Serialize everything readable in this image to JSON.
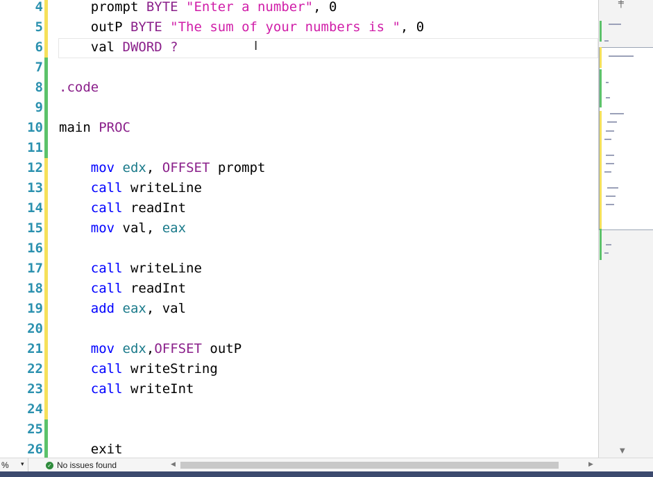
{
  "editor": {
    "lines": [
      {
        "num": "4",
        "marker": "yellow",
        "tokens": [
          {
            "t": "    "
          },
          {
            "t": "prompt ",
            "c": "lbl"
          },
          {
            "t": "BYTE ",
            "c": "dir"
          },
          {
            "t": "\"Enter a number\"",
            "c": "str"
          },
          {
            "t": ", 0"
          }
        ]
      },
      {
        "num": "5",
        "marker": "yellow",
        "tokens": [
          {
            "t": "    "
          },
          {
            "t": "outP ",
            "c": "lbl"
          },
          {
            "t": "BYTE ",
            "c": "dir"
          },
          {
            "t": "\"The sum of your numbers is \"",
            "c": "str"
          },
          {
            "t": ", 0"
          }
        ]
      },
      {
        "num": "6",
        "marker": "yellow",
        "tokens": [
          {
            "t": "    "
          },
          {
            "t": "val ",
            "c": "lbl"
          },
          {
            "t": "DWORD ?",
            "c": "dir"
          }
        ],
        "current": true
      },
      {
        "num": "7",
        "marker": "green",
        "tokens": []
      },
      {
        "num": "8",
        "marker": "green",
        "tokens": [
          {
            "t": ".code",
            "c": "dir"
          }
        ]
      },
      {
        "num": "9",
        "marker": "green",
        "tokens": []
      },
      {
        "num": "10",
        "marker": "green",
        "tokens": [
          {
            "t": "main "
          },
          {
            "t": "PROC",
            "c": "dir"
          }
        ]
      },
      {
        "num": "11",
        "marker": "green",
        "tokens": []
      },
      {
        "num": "12",
        "marker": "yellow",
        "tokens": [
          {
            "t": "    "
          },
          {
            "t": "mov ",
            "c": "kw"
          },
          {
            "t": "edx",
            "c": "reg"
          },
          {
            "t": ", "
          },
          {
            "t": "OFFSET ",
            "c": "dir"
          },
          {
            "t": "prompt"
          }
        ]
      },
      {
        "num": "13",
        "marker": "yellow",
        "tokens": [
          {
            "t": "    "
          },
          {
            "t": "call ",
            "c": "kw"
          },
          {
            "t": "writeLine"
          }
        ]
      },
      {
        "num": "14",
        "marker": "yellow",
        "tokens": [
          {
            "t": "    "
          },
          {
            "t": "call ",
            "c": "kw"
          },
          {
            "t": "readInt"
          }
        ]
      },
      {
        "num": "15",
        "marker": "yellow",
        "tokens": [
          {
            "t": "    "
          },
          {
            "t": "mov ",
            "c": "kw"
          },
          {
            "t": "val, "
          },
          {
            "t": "eax",
            "c": "reg"
          }
        ]
      },
      {
        "num": "16",
        "marker": "yellow",
        "tokens": []
      },
      {
        "num": "17",
        "marker": "yellow",
        "tokens": [
          {
            "t": "    "
          },
          {
            "t": "call ",
            "c": "kw"
          },
          {
            "t": "writeLine"
          }
        ]
      },
      {
        "num": "18",
        "marker": "yellow",
        "tokens": [
          {
            "t": "    "
          },
          {
            "t": "call ",
            "c": "kw"
          },
          {
            "t": "readInt"
          }
        ]
      },
      {
        "num": "19",
        "marker": "yellow",
        "tokens": [
          {
            "t": "    "
          },
          {
            "t": "add ",
            "c": "kw"
          },
          {
            "t": "eax",
            "c": "reg"
          },
          {
            "t": ", val"
          }
        ]
      },
      {
        "num": "20",
        "marker": "yellow",
        "tokens": []
      },
      {
        "num": "21",
        "marker": "yellow",
        "tokens": [
          {
            "t": "    "
          },
          {
            "t": "mov ",
            "c": "kw"
          },
          {
            "t": "edx",
            "c": "reg"
          },
          {
            "t": ","
          },
          {
            "t": "OFFSET ",
            "c": "dir"
          },
          {
            "t": "outP"
          }
        ]
      },
      {
        "num": "22",
        "marker": "yellow",
        "tokens": [
          {
            "t": "    "
          },
          {
            "t": "call ",
            "c": "kw"
          },
          {
            "t": "writeString"
          }
        ]
      },
      {
        "num": "23",
        "marker": "yellow",
        "tokens": [
          {
            "t": "    "
          },
          {
            "t": "call ",
            "c": "kw"
          },
          {
            "t": "writeInt"
          }
        ]
      },
      {
        "num": "24",
        "marker": "yellow",
        "tokens": []
      },
      {
        "num": "25",
        "marker": "green",
        "tokens": []
      },
      {
        "num": "26",
        "marker": "green",
        "tokens": [
          {
            "t": "    "
          },
          {
            "t": "exit"
          }
        ]
      }
    ]
  },
  "colors": {
    "marker_yellow": "#f5e05a",
    "marker_green": "#5cc26a",
    "line_number": "#2b91af",
    "keyword": "#0000ff",
    "directive": "#8a1f8a",
    "register": "#1a7a8a",
    "string": "#d01ea8"
  },
  "status": {
    "zoom": "%",
    "issues_label": "No issues found"
  },
  "icons": {
    "issues": "check-circle-icon",
    "split": "split-window-icon",
    "cursor": "text-cursor-icon"
  }
}
